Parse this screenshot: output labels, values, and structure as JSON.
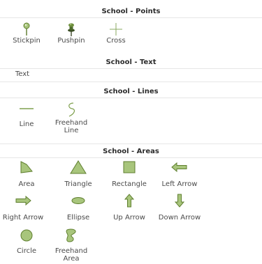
{
  "sections": {
    "points": {
      "title": "School - Points",
      "tools": [
        {
          "label": "Stickpin",
          "icon": "stickpin-icon"
        },
        {
          "label": "Pushpin",
          "icon": "pushpin-icon"
        },
        {
          "label": "Cross",
          "icon": "cross-icon"
        }
      ]
    },
    "text": {
      "title": "School - Text",
      "tools": [
        {
          "label": "Text",
          "icon": "text-icon"
        }
      ]
    },
    "lines": {
      "title": "School - Lines",
      "tools": [
        {
          "label": "Line",
          "icon": "line-icon"
        },
        {
          "label": "Freehand Line",
          "icon": "freehand-line-icon"
        }
      ]
    },
    "areas": {
      "title": "School - Areas",
      "tools": [
        {
          "label": "Area",
          "icon": "area-icon"
        },
        {
          "label": "Triangle",
          "icon": "triangle-icon"
        },
        {
          "label": "Rectangle",
          "icon": "rectangle-icon"
        },
        {
          "label": "Left Arrow",
          "icon": "left-arrow-icon"
        },
        {
          "label": "Right Arrow",
          "icon": "right-arrow-icon"
        },
        {
          "label": "Ellipse",
          "icon": "ellipse-icon"
        },
        {
          "label": "Up Arrow",
          "icon": "up-arrow-icon"
        },
        {
          "label": "Down Arrow",
          "icon": "down-arrow-icon"
        },
        {
          "label": "Circle",
          "icon": "circle-icon"
        },
        {
          "label": "Freehand Area",
          "icon": "freehand-area-icon"
        }
      ]
    }
  },
  "colors": {
    "fill": "#a8c57c",
    "stroke": "#5f7f2f",
    "text": "#4a4a4a",
    "header": "#2b2b2b",
    "divider": "#e6e6e6"
  }
}
